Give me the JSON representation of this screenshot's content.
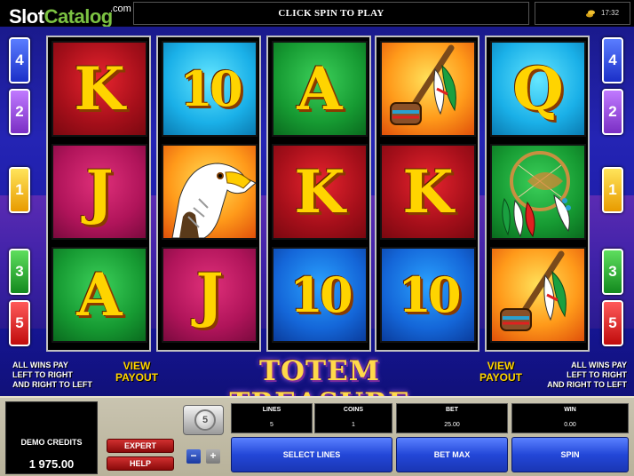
{
  "logo": {
    "part1": "Slot",
    "part2": "Catalog",
    "sup": ".com"
  },
  "header": {
    "message": "CLICK SPIN TO PLAY",
    "clock": "17:32"
  },
  "line_indicators": {
    "left": [
      "4",
      "2",
      "1",
      "3",
      "5"
    ],
    "right": [
      "4",
      "2",
      "1",
      "3",
      "5"
    ]
  },
  "reels": [
    [
      {
        "symbol": "K",
        "bg": "red"
      },
      {
        "symbol": "J",
        "bg": "magenta"
      },
      {
        "symbol": "A",
        "bg": "green"
      }
    ],
    [
      {
        "symbol": "10",
        "bg": "aqua"
      },
      {
        "symbol": "eagle",
        "bg": "orange"
      },
      {
        "symbol": "J",
        "bg": "magenta"
      }
    ],
    [
      {
        "symbol": "A",
        "bg": "green"
      },
      {
        "symbol": "K",
        "bg": "red"
      },
      {
        "symbol": "10",
        "bg": "blue"
      }
    ],
    [
      {
        "symbol": "pipe",
        "bg": "orange"
      },
      {
        "symbol": "K",
        "bg": "red"
      },
      {
        "symbol": "10",
        "bg": "blue"
      }
    ],
    [
      {
        "symbol": "Q",
        "bg": "aqua"
      },
      {
        "symbol": "dreamcatcher",
        "bg": "green"
      },
      {
        "symbol": "pipe",
        "bg": "orange"
      }
    ]
  ],
  "info": {
    "left_text": [
      "ALL WINS PAY",
      "LEFT TO RIGHT",
      "AND RIGHT TO LEFT"
    ],
    "right_text": [
      "ALL WINS PAY",
      "LEFT TO RIGHT",
      "AND RIGHT TO LEFT"
    ],
    "view_payout": [
      "VIEW",
      "PAYOUT"
    ],
    "title": "TOTEM TREASURE"
  },
  "panel": {
    "credits_label": "DEMO CREDITS",
    "credits_value": "1 975.00",
    "expert_label": "EXPERT",
    "help_label": "HELP",
    "coin_value": "5",
    "minus_label": "−",
    "plus_label": "+",
    "stats": [
      {
        "label": "LINES",
        "value": "5"
      },
      {
        "label": "COINS",
        "value": "1"
      },
      {
        "label": "BET",
        "value": "25.00"
      },
      {
        "label": "WIN",
        "value": "0.00"
      }
    ],
    "select_lines_label": "SELECT LINES",
    "bet_max_label": "BET MAX",
    "spin_label": "SPIN"
  },
  "colors": {
    "accent_yellow": "#ffd400",
    "panel": "#c9c4b0",
    "button_blue": "#2347d8",
    "button_red": "#b01818"
  }
}
